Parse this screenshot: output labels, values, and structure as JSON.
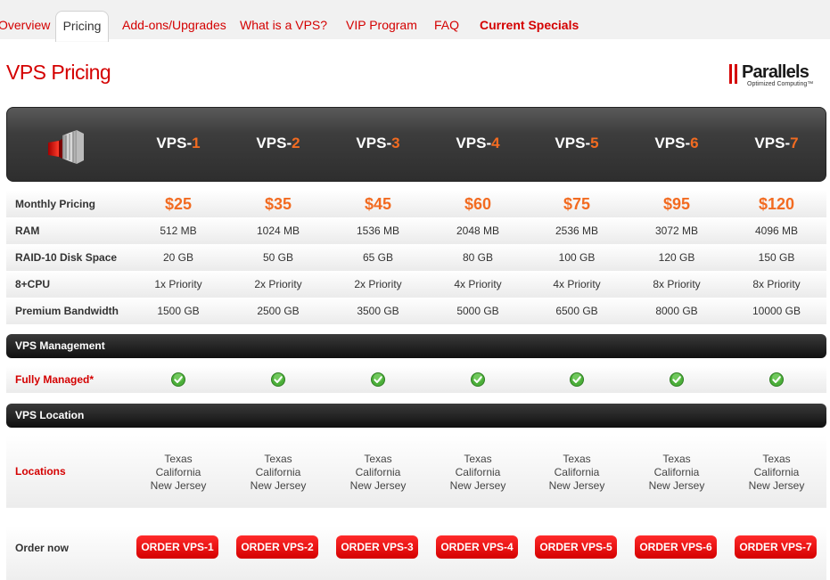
{
  "tabs": [
    {
      "label": "Overview"
    },
    {
      "label": "Pricing"
    },
    {
      "label": "Add-ons/Upgrades"
    },
    {
      "label": "What is a VPS?"
    },
    {
      "label": "VIP Program"
    },
    {
      "label": "FAQ"
    },
    {
      "label": "Current Specials"
    }
  ],
  "page_title": "VPS Pricing",
  "logo": {
    "name": "Parallels",
    "tagline": "Optimized Computing™"
  },
  "plans": [
    {
      "prefix": "VPS-",
      "num": "1"
    },
    {
      "prefix": "VPS-",
      "num": "2"
    },
    {
      "prefix": "VPS-",
      "num": "3"
    },
    {
      "prefix": "VPS-",
      "num": "4"
    },
    {
      "prefix": "VPS-",
      "num": "5"
    },
    {
      "prefix": "VPS-",
      "num": "6"
    },
    {
      "prefix": "VPS-",
      "num": "7"
    }
  ],
  "rows": {
    "monthly": {
      "label": "Monthly Pricing",
      "values": [
        "$25",
        "$35",
        "$45",
        "$60",
        "$75",
        "$95",
        "$120"
      ]
    },
    "ram": {
      "label": "RAM",
      "values": [
        "512 MB",
        "1024 MB",
        "1536 MB",
        "2048 MB",
        "2536 MB",
        "3072 MB",
        "4096 MB"
      ]
    },
    "disk": {
      "label": "RAID-10 Disk Space",
      "values": [
        "20 GB",
        "50 GB",
        "65 GB",
        "80 GB",
        "100 GB",
        "120 GB",
        "150 GB"
      ]
    },
    "cpu": {
      "label": "8+CPU",
      "values": [
        "1x Priority",
        "2x Priority",
        "2x Priority",
        "4x Priority",
        "4x Priority",
        "8x Priority",
        "8x Priority"
      ]
    },
    "bandwidth": {
      "label": "Premium Bandwidth",
      "values": [
        "1500 GB",
        "2500 GB",
        "3500 GB",
        "5000 GB",
        "6500 GB",
        "8000 GB",
        "10000 GB"
      ]
    }
  },
  "management": {
    "section_title": "VPS Management",
    "label": "Fully Managed",
    "asterisk": "*",
    "icon": "checkmark-icon"
  },
  "location": {
    "section_title": "VPS Location",
    "label": "Locations",
    "lines": [
      "Texas",
      "California",
      "New Jersey"
    ]
  },
  "order": {
    "label": "Order now",
    "buttons": [
      "ORDER VPS-1",
      "ORDER VPS-2",
      "ORDER VPS-3",
      "ORDER VPS-4",
      "ORDER VPS-5",
      "ORDER VPS-6",
      "ORDER VPS-7"
    ]
  },
  "colors": {
    "accent_red": "#d40000",
    "price_orange": "#f26b21",
    "check_green": "#4caf3a"
  }
}
